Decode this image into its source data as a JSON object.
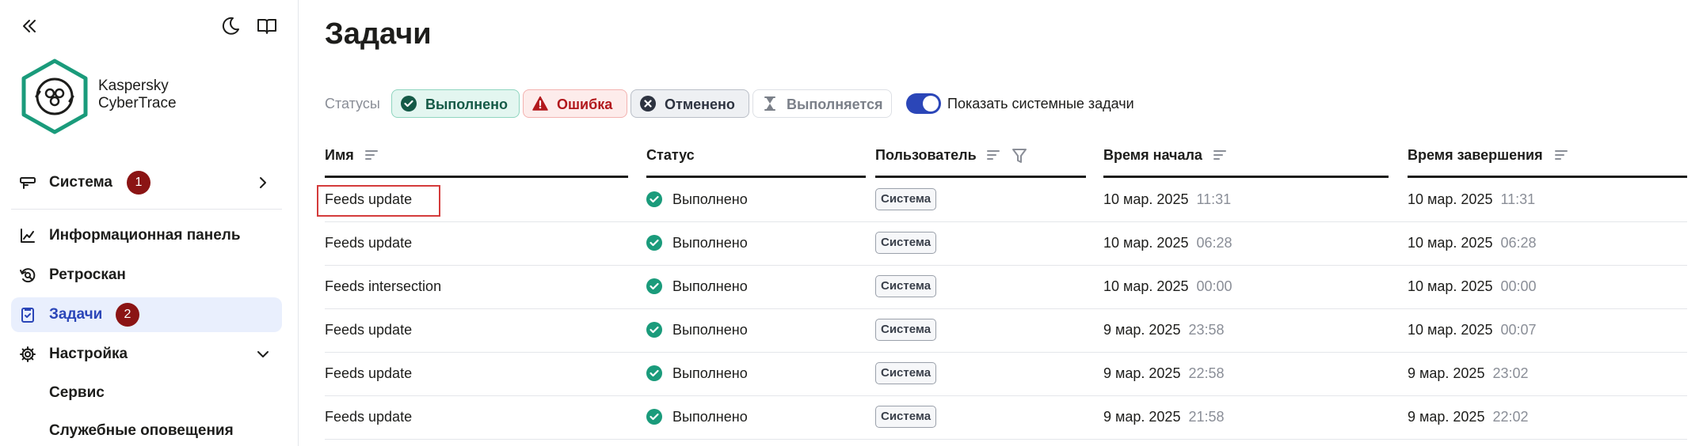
{
  "sidebar": {
    "brand": {
      "line1": "Kaspersky",
      "line2": "CyberTrace"
    },
    "system": {
      "label": "Система",
      "badge": "1"
    },
    "items": [
      {
        "label": "Информационная панель"
      },
      {
        "label": "Ретроскан"
      },
      {
        "label": "Задачи",
        "badge": "2"
      },
      {
        "label": "Настройка"
      }
    ],
    "subitems": [
      {
        "label": "Сервис"
      },
      {
        "label": "Служебные оповещения"
      }
    ]
  },
  "page": {
    "title": "Задачи"
  },
  "filters": {
    "label": "Статусы",
    "chips": [
      {
        "label": "Выполнено",
        "icon": "check-circle-icon"
      },
      {
        "label": "Ошибка",
        "icon": "warning-icon"
      },
      {
        "label": "Отменено",
        "icon": "x-circle-icon"
      },
      {
        "label": "Выполняется",
        "icon": "hourglass-icon"
      }
    ],
    "toggle_label": "Показать системные задачи",
    "toggle_on": true
  },
  "table": {
    "columns": [
      "Имя",
      "Статус",
      "Пользователь",
      "Время начала",
      "Время завершения"
    ],
    "rows": [
      {
        "name": "Feeds update",
        "status": "Выполнено",
        "user": "Система",
        "start_date": "10 мар. 2025",
        "start_time": "11:31",
        "end_date": "10 мар. 2025",
        "end_time": "11:31"
      },
      {
        "name": "Feeds update",
        "status": "Выполнено",
        "user": "Система",
        "start_date": "10 мар. 2025",
        "start_time": "06:28",
        "end_date": "10 мар. 2025",
        "end_time": "06:28"
      },
      {
        "name": "Feeds intersection",
        "status": "Выполнено",
        "user": "Система",
        "start_date": "10 мар. 2025",
        "start_time": "00:00",
        "end_date": "10 мар. 2025",
        "end_time": "00:00"
      },
      {
        "name": "Feeds update",
        "status": "Выполнено",
        "user": "Система",
        "start_date": "9 мар. 2025",
        "start_time": "23:58",
        "end_date": "10 мар. 2025",
        "end_time": "00:07"
      },
      {
        "name": "Feeds update",
        "status": "Выполнено",
        "user": "Система",
        "start_date": "9 мар. 2025",
        "start_time": "22:58",
        "end_date": "9 мар. 2025",
        "end_time": "23:02"
      },
      {
        "name": "Feeds update",
        "status": "Выполнено",
        "user": "Система",
        "start_date": "9 мар. 2025",
        "start_time": "21:58",
        "end_date": "9 мар. 2025",
        "end_time": "22:02"
      }
    ]
  },
  "colors": {
    "accent": "#2b46b8",
    "success": "#1a9b7b",
    "error": "#c62828",
    "badge": "#8b1414",
    "highlight_border": "#d43b3b"
  }
}
